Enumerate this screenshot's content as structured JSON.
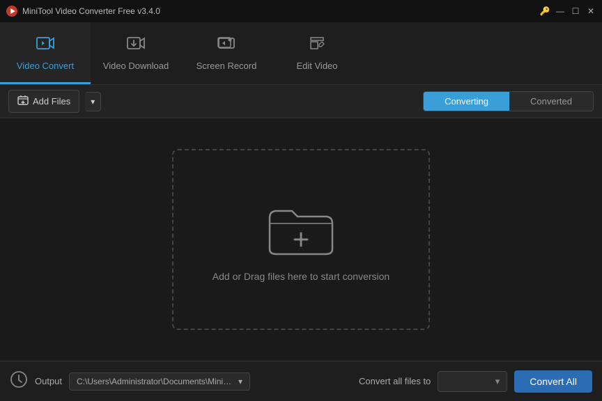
{
  "app": {
    "title": "MiniTool Video Converter Free v3.4.0"
  },
  "window_controls": {
    "settings_icon": "⚙",
    "minimize": "—",
    "maximize": "☐",
    "close": "✕"
  },
  "nav": {
    "items": [
      {
        "id": "video-convert",
        "label": "Video Convert",
        "active": true
      },
      {
        "id": "video-download",
        "label": "Video Download",
        "active": false
      },
      {
        "id": "screen-record",
        "label": "Screen Record",
        "active": false
      },
      {
        "id": "edit-video",
        "label": "Edit Video",
        "active": false
      }
    ]
  },
  "toolbar": {
    "add_files_label": "Add Files",
    "tab_converting": "Converting",
    "tab_converted": "Converted"
  },
  "main": {
    "drop_text": "Add or Drag files here to start conversion"
  },
  "bottom_bar": {
    "output_label": "Output",
    "output_path": "C:\\Users\\Administrator\\Documents\\MiniTool Video Converter",
    "convert_all_files_to_label": "Convert all files to",
    "convert_all_btn": "Convert All"
  }
}
